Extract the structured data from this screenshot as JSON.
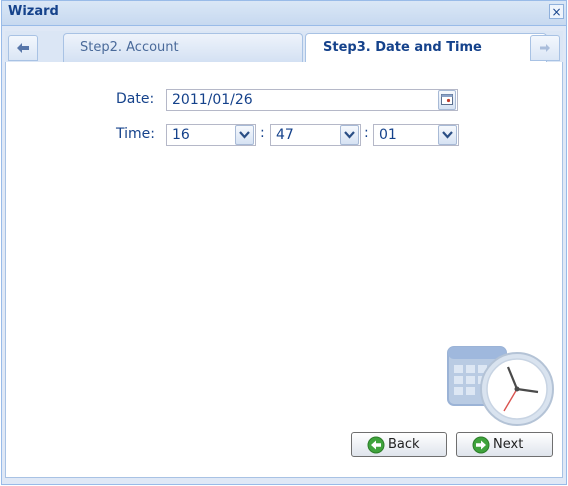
{
  "window": {
    "title": "Wizard",
    "close_glyph": "×"
  },
  "tabs": {
    "prev_icon": "arrow-left-icon",
    "next_icon": "arrow-right-icon",
    "items": [
      {
        "label": "Step2. Account",
        "active": false
      },
      {
        "label": "Step3. Date and Time",
        "active": true
      }
    ]
  },
  "form": {
    "date_label": "Date:",
    "date_value": "2011/01/26",
    "time_label": "Time:",
    "hour": "16",
    "minute": "47",
    "second": "01",
    "separator": ":"
  },
  "buttons": {
    "back": "Back",
    "next": "Next"
  },
  "colors": {
    "accent": "#15428b",
    "border": "#99bbe8",
    "button_icon": "#3fa33c"
  }
}
